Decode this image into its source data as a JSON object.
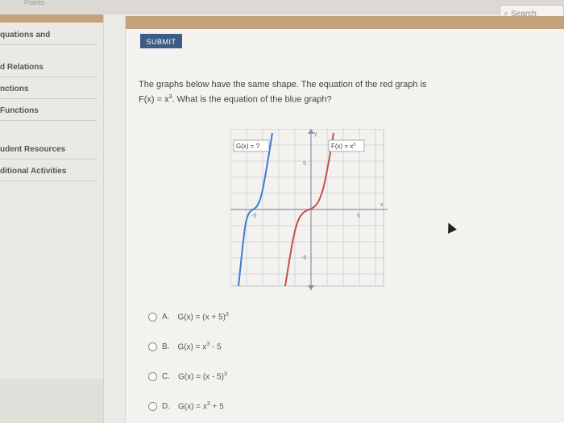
{
  "top": {
    "tab_label": "Points",
    "search_label": "Search"
  },
  "sidebar": {
    "items": [
      {
        "label": "quations and"
      },
      {
        "label": "d Relations"
      },
      {
        "label": "nctions"
      },
      {
        "label": "Functions"
      },
      {
        "label": "udent Resources"
      },
      {
        "label": "ditional Activities"
      }
    ]
  },
  "main": {
    "submit_label": "SUBMIT",
    "question_line1": "The graphs below have the same shape. The equation of the red graph is",
    "question_line2_pre": "F(x) = x",
    "question_line2_exp": "3",
    "question_line2_post": ". What is the equation of the blue graph?"
  },
  "graph": {
    "blue_label": "G(x) = ?",
    "red_label": "F(x) = x",
    "red_label_exp": "3",
    "axis_y": "y",
    "axis_x": "x",
    "tick_5_top": "5",
    "tick_5_bottom": "-5",
    "tick_neg5_x": "-5",
    "tick_5_x": "5",
    "colors": {
      "blue": "#3a7bd5",
      "red": "#c0504d",
      "axis": "#8a8fa8"
    }
  },
  "options": [
    {
      "letter": "A.",
      "pre": "G(x) = (x + 5)",
      "exp": "3",
      "post": ""
    },
    {
      "letter": "B.",
      "pre": "G(x) = x",
      "exp": "3",
      "post": " - 5"
    },
    {
      "letter": "C.",
      "pre": "G(x) = (x - 5)",
      "exp": "3",
      "post": ""
    },
    {
      "letter": "D.",
      "pre": "G(x) = x",
      "exp": "3",
      "post": " + 5"
    }
  ]
}
